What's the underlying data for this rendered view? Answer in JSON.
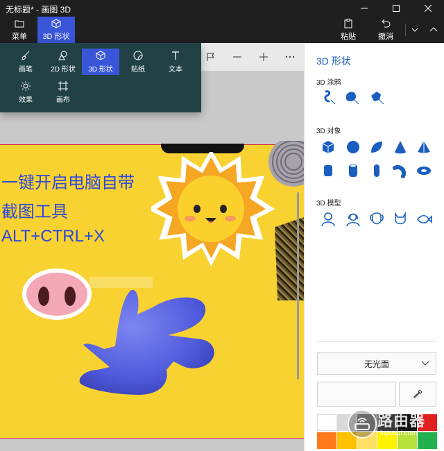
{
  "window": {
    "title": "无标题* - 画图 3D"
  },
  "ribbon": {
    "menu_label": "菜单",
    "shapes3d_label": "3D 形状",
    "paste_label": "粘贴",
    "undo_label": "撤消"
  },
  "popup_menu": {
    "items": [
      {
        "label": "画笔",
        "icon": "brush-icon"
      },
      {
        "label": "2D 形状",
        "icon": "2d-shapes-icon"
      },
      {
        "label": "3D 形状",
        "icon": "3d-shapes-icon",
        "active": true
      },
      {
        "label": "贴纸",
        "icon": "sticker-icon"
      },
      {
        "label": "文本",
        "icon": "text-icon"
      },
      {
        "label": "效果",
        "icon": "effects-icon"
      },
      {
        "label": "画布",
        "icon": "canvas-icon"
      }
    ]
  },
  "canvas": {
    "line1": "一键开启电脑自带",
    "line2": "截图工具",
    "line3": "ALT+CTRL+X"
  },
  "panel": {
    "title": "3D 形状",
    "sec_doodle": "3D 涂鸦",
    "sec_objects": "3D 对象",
    "sec_models": "3D 模型",
    "finish": "无光面"
  },
  "colors": {
    "accent": "#3a56d8",
    "canvas_bg": "#f8d231",
    "shape_blue": "#5561e0",
    "swatches_row1": [
      "#ffffff",
      "#d9d9d9",
      "#8c8c8c",
      "#3a3a3a",
      "#111111",
      "#e02020"
    ],
    "swatches_row2": [
      "#ff7a1a",
      "#ffc000",
      "#ffe066",
      "#fff200",
      "#b7e13b",
      "#22b14c"
    ]
  },
  "watermark": {
    "name": "路由器",
    "site": "luyouqi.com"
  }
}
